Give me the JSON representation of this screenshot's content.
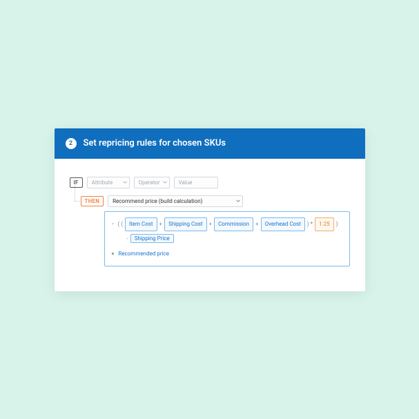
{
  "header": {
    "step_number": "2",
    "title": "Set repricing rules for chosen SKUs"
  },
  "rule": {
    "if_keyword": "IF",
    "attribute_placeholder": "Attribute",
    "operator_placeholder": "Operator",
    "value_placeholder": "Value",
    "then_keyword": "THEN",
    "action_label": "Recommend price (build calculation)"
  },
  "calc": {
    "open_group": "( (",
    "item_cost": "Item Cost",
    "plus1": "+",
    "shipping_cost": "Shipping Cost",
    "plus2": "+",
    "commission": "Commission",
    "plus3": "+",
    "overhead_cost": "Overhead Cost",
    "close_paren_mult": " ) *",
    "multiplier": "1.25",
    "close_group": ")",
    "minus": "-",
    "shipping_price": "Shipping Price",
    "equals": "=",
    "result_label": "Recommended price"
  }
}
